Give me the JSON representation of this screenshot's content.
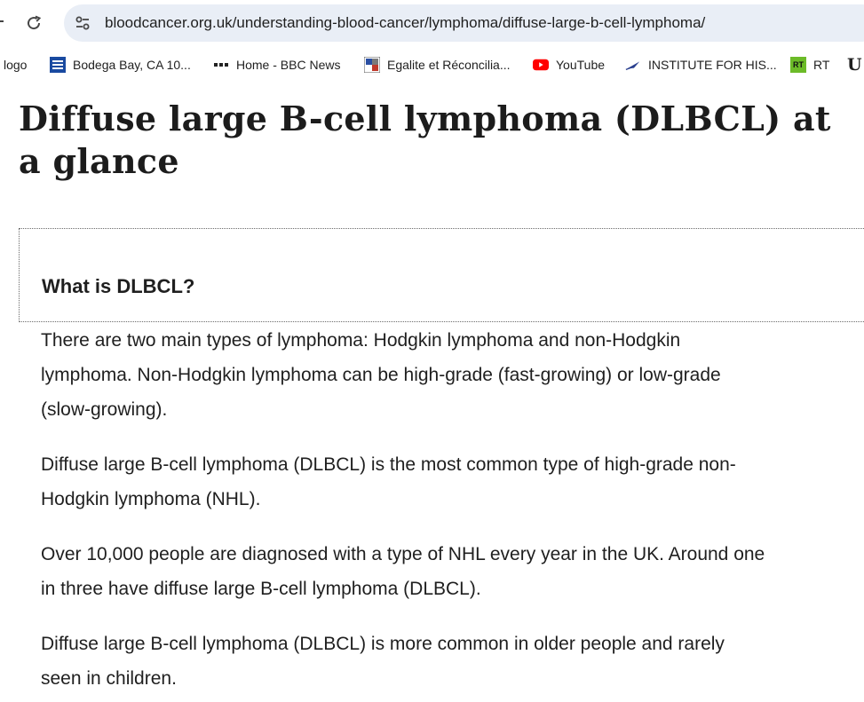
{
  "browser": {
    "url": "bloodcancer.org.uk/understanding-blood-cancer/lymphoma/diffuse-large-b-cell-lymphoma/"
  },
  "bookmarks": [
    {
      "label": "logo",
      "icon": "none"
    },
    {
      "label": "Bodega Bay, CA 10...",
      "icon": "weather-channel-icon",
      "icon_text": "The Weather Channel"
    },
    {
      "label": "Home - BBC News",
      "icon": "bbc-icon"
    },
    {
      "label": "Egalite et Réconcilia...",
      "icon": "egalite-icon"
    },
    {
      "label": "YouTube",
      "icon": "youtube-icon"
    },
    {
      "label": "INSTITUTE FOR HIS...",
      "icon": "institute-icon"
    },
    {
      "label": "RT",
      "icon": "rt-icon",
      "icon_text": "RT"
    },
    {
      "label": "U",
      "icon": "none"
    }
  ],
  "page": {
    "title": "Diffuse large B-cell lymphoma (DLBCL) at a glance",
    "accordion_heading": "What is DLBCL?",
    "paragraphs": [
      "There are two main types of lymphoma: Hodgkin lymphoma and non-Hodgkin lymphoma. Non-Hodgkin lymphoma can be high-grade (fast-growing) or low-grade (slow-growing).",
      "Diffuse large B-cell lymphoma (DLBCL) is the most common type of high-grade non-Hodgkin lymphoma (NHL).",
      "Over 10,000 people are diagnosed with a type of NHL every year in the UK. Around one in three have diffuse large B-cell lymphoma (DLBCL).",
      "Diffuse large B-cell lymphoma (DLBCL) is more common in older people and rarely seen in children."
    ]
  },
  "colors": {
    "omnibox_bg": "#e9eef6",
    "text": "#1f1f1f",
    "youtube_red": "#ff0000",
    "rt_green": "#6cbb28"
  }
}
